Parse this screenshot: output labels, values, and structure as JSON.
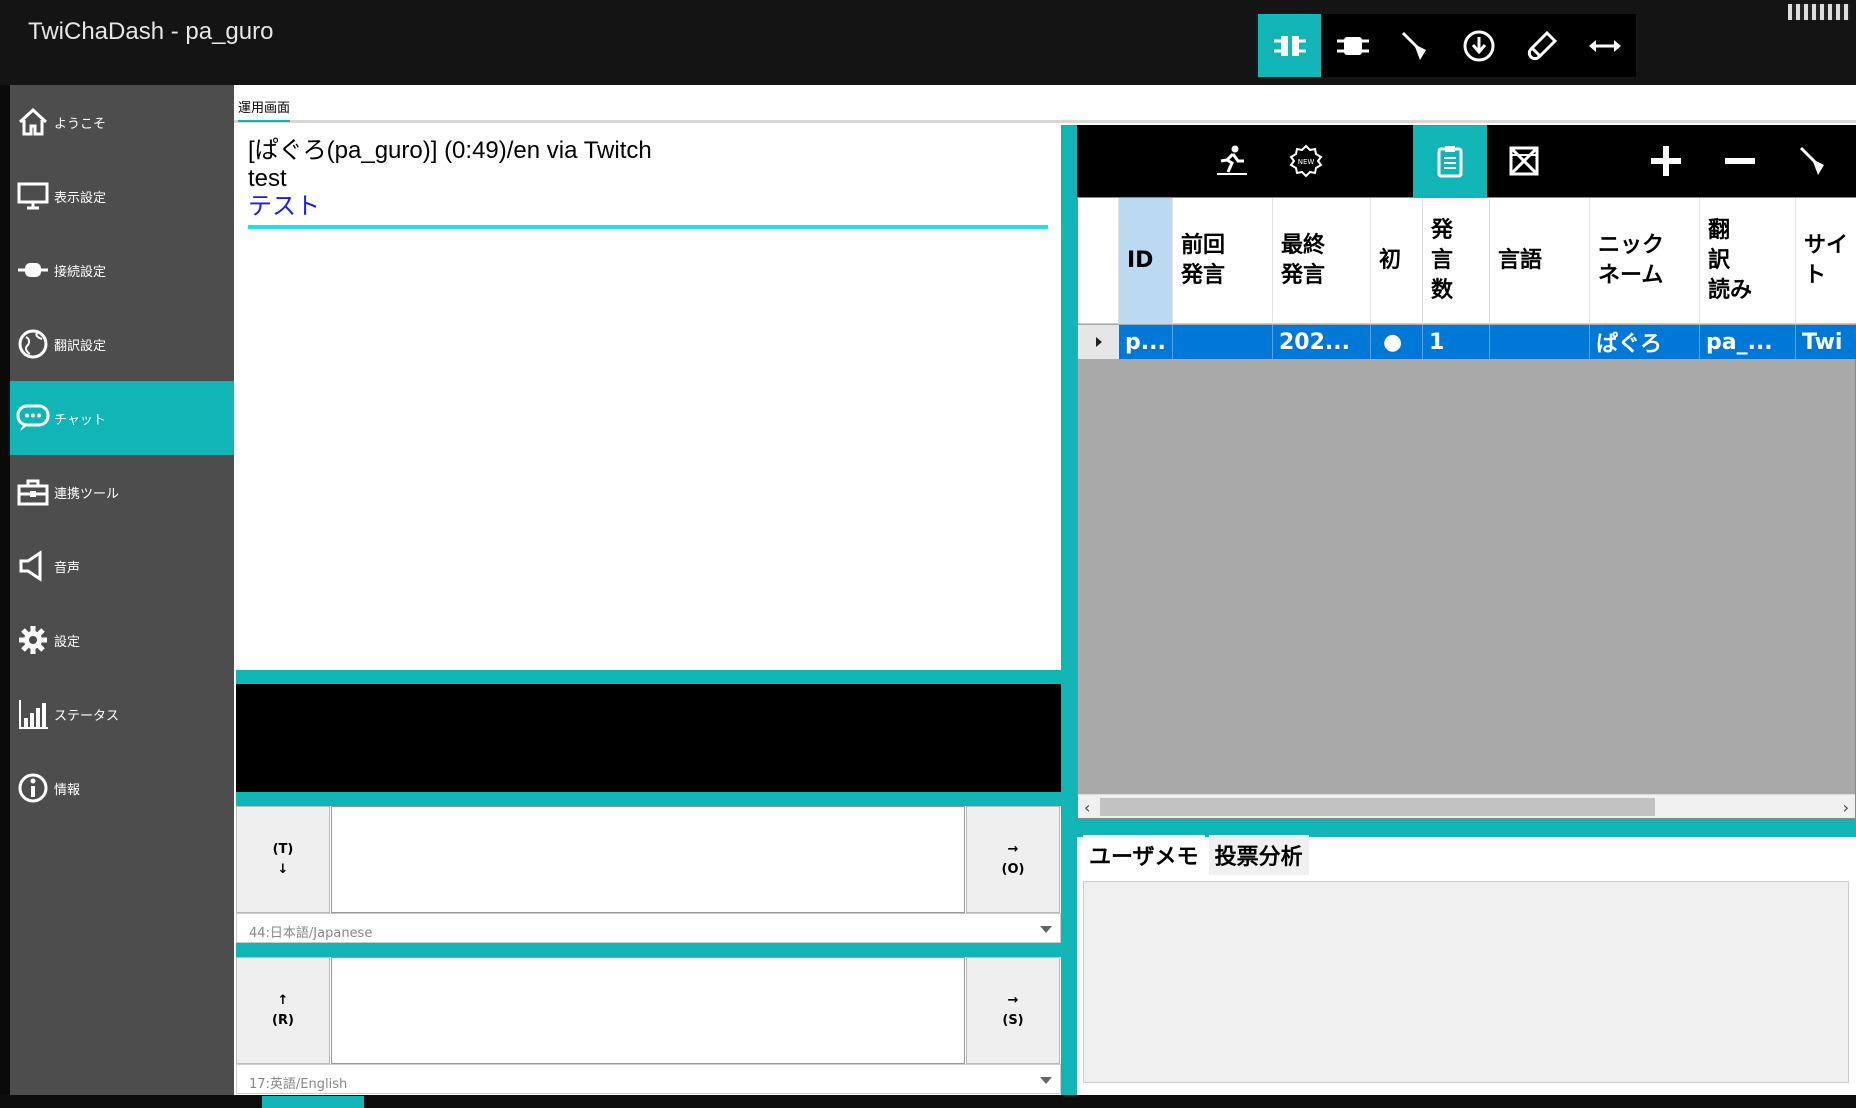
{
  "app": {
    "title": "TwiChaDash - pa_guro"
  },
  "topbar": {
    "buttons": [
      {
        "icon": "connect-icon",
        "active": true
      },
      {
        "icon": "plug-icon",
        "active": false
      },
      {
        "icon": "broom-icon",
        "active": false
      },
      {
        "icon": "download-icon",
        "active": false
      },
      {
        "icon": "test-tube-icon",
        "active": false
      },
      {
        "icon": "horizontal-arrows-icon",
        "active": false
      }
    ]
  },
  "sidebar": {
    "items": [
      {
        "label": "ようこそ",
        "icon": "home-icon"
      },
      {
        "label": "表示設定",
        "icon": "monitor-icon"
      },
      {
        "label": "接続設定",
        "icon": "plug-icon"
      },
      {
        "label": "翻訳設定",
        "icon": "globe-icon"
      },
      {
        "label": "チャット",
        "icon": "chat-icon",
        "active": true
      },
      {
        "label": "連携ツール",
        "icon": "toolbox-icon"
      },
      {
        "label": "音声",
        "icon": "speaker-icon"
      },
      {
        "label": "設定",
        "icon": "gear-icon"
      },
      {
        "label": "ステータス",
        "icon": "bar-chart-icon"
      },
      {
        "label": "情報",
        "icon": "info-icon"
      }
    ]
  },
  "tab": {
    "label": "運用画面"
  },
  "chat": {
    "header": "[ぱぐろ(pa_guro)] (0:49)/en via Twitch",
    "message": "test",
    "translation": "テスト"
  },
  "input1": {
    "left_label_1": "(T)",
    "left_label_2": "↓",
    "right_label_1": "→",
    "right_label_2": "(O)",
    "language": "44:日本語/Japanese"
  },
  "input2": {
    "left_label_1": "↑",
    "left_label_2": "(R)",
    "right_label_1": "→",
    "right_label_2": "(S)",
    "language": "17:英語/English"
  },
  "right_toolbar": {
    "buttons": [
      {
        "icon": "runner-icon"
      },
      {
        "icon": "new-badge-icon"
      },
      {
        "icon": "clipboard-icon",
        "active": true
      },
      {
        "icon": "box-x-icon"
      },
      {
        "icon": "plus-icon"
      },
      {
        "icon": "minus-icon"
      },
      {
        "icon": "broom-icon"
      }
    ]
  },
  "user_grid": {
    "columns": [
      "ID",
      "前回\n発言",
      "最終\n発言",
      "初",
      "発\n言\n数",
      "言語",
      "ニック\nネーム",
      "翻\n訳\n読み",
      "サイ\nト"
    ],
    "rows": [
      [
        "p...",
        "",
        "202...",
        "●",
        "1",
        "",
        "ぱぐろ",
        "pa_...",
        "Twi"
      ]
    ]
  },
  "memo": {
    "tabs": [
      "ユーザメモ",
      "投票分析"
    ]
  },
  "colors": {
    "accent": "#12b5b5",
    "selection": "#0078d7",
    "sidebar": "#4d4d4d",
    "titlebar": "#141414"
  }
}
